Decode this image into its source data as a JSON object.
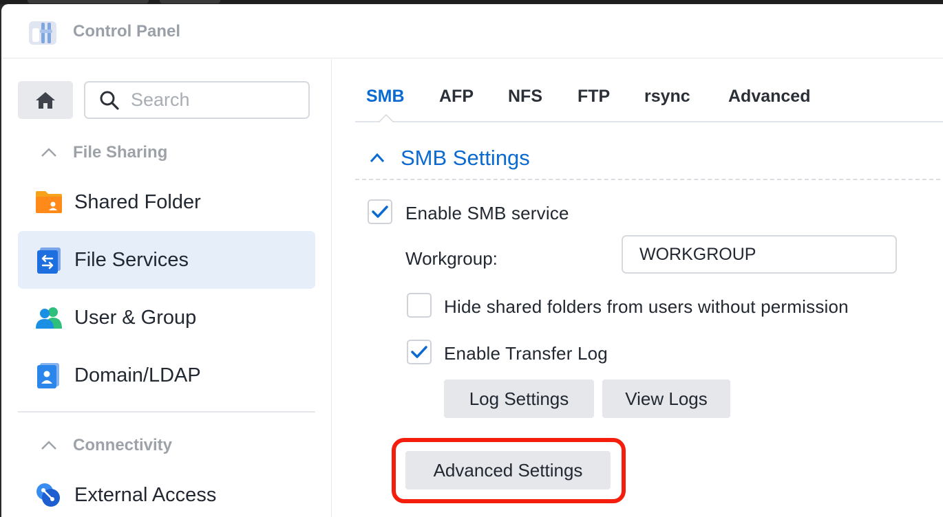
{
  "window": {
    "title": "Control Panel"
  },
  "sidebar": {
    "search_placeholder": "Search",
    "sections": [
      {
        "label": "File Sharing"
      },
      {
        "label": "Connectivity"
      }
    ],
    "items": [
      {
        "label": "Shared Folder",
        "icon": "folder-icon"
      },
      {
        "label": "File Services",
        "icon": "file-services-icon",
        "active": true
      },
      {
        "label": "User & Group",
        "icon": "users-icon"
      },
      {
        "label": "Domain/LDAP",
        "icon": "domain-icon"
      },
      {
        "label": "External Access",
        "icon": "external-access-icon"
      }
    ]
  },
  "tabs": [
    {
      "label": "SMB",
      "active": true
    },
    {
      "label": "AFP"
    },
    {
      "label": "NFS"
    },
    {
      "label": "FTP"
    },
    {
      "label": "rsync"
    },
    {
      "label": "Advanced"
    }
  ],
  "smb": {
    "section_title": "SMB Settings",
    "enable_service": {
      "label": "Enable SMB service",
      "checked": true
    },
    "workgroup": {
      "label": "Workgroup:",
      "value": "WORKGROUP"
    },
    "hide_shared": {
      "label": "Hide shared folders from users without permission",
      "checked": false
    },
    "transfer_log": {
      "label": "Enable Transfer Log",
      "checked": true
    },
    "buttons": {
      "log_settings": "Log Settings",
      "view_logs": "View Logs",
      "advanced_settings": "Advanced Settings"
    }
  },
  "colors": {
    "accent": "#0a6ad1",
    "highlight": "#f51e0d",
    "active_bg": "#e6eef9"
  }
}
